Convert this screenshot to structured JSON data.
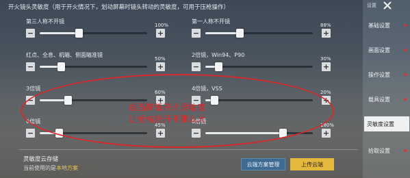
{
  "header": {
    "title": "开火镜头灵敏度（用于开火情况下，划动屏幕时镜头转动的灵敏度，可用于压枪操作）"
  },
  "sliders": [
    {
      "id": "third-person-no-scope",
      "label": "第三人称不开镜",
      "value": "100%",
      "fraction": 0.36
    },
    {
      "id": "first-person-no-scope",
      "label": "第一人称不开镜",
      "value": "88%",
      "fraction": 0.32
    },
    {
      "id": "red-dot-holo",
      "label": "红点、全息、机瞄、侧面瞄准镜",
      "value": "50%",
      "fraction": 0.2
    },
    {
      "id": "scope-2x",
      "label": "2倍镜，Win94、P90",
      "value": "30%",
      "fraction": 0.12
    },
    {
      "id": "scope-3x",
      "label": "3倍镜",
      "value": "60%",
      "fraction": 0.26
    },
    {
      "id": "scope-4x",
      "label": "4倍镜，VSS",
      "value": "20%",
      "fraction": 0.08
    },
    {
      "id": "scope-6x",
      "label": "6倍镜",
      "value": "45%",
      "fraction": 0.18
    },
    {
      "id": "scope-8x",
      "label": "8倍镜",
      "value": "180%",
      "fraction": 0.72
    }
  ],
  "annotation": {
    "line1": "适当降低开火灵敏度",
    "line2": "让枪械抬升不那么大"
  },
  "cloud": {
    "title": "灵敏度云存储",
    "current_prefix": "当前使用的是",
    "current_plan": "本地方案",
    "manage_label": "云端方案管理",
    "upload_label": "上传云端"
  },
  "sidebar": {
    "top_label": "设置",
    "items": [
      {
        "label": "基础设置"
      },
      {
        "label": "画面设置"
      },
      {
        "label": "操作设置"
      },
      {
        "label": "载具设置"
      },
      {
        "label": "灵敏度设置"
      },
      {
        "label": "拾取设置"
      }
    ],
    "active_index": 4
  },
  "colors": {
    "annotation_red": "#e0262a",
    "upload_yellow": "#e3b83c",
    "manage_blue": "#3e6b92",
    "plan_highlight": "#e7c34a"
  }
}
